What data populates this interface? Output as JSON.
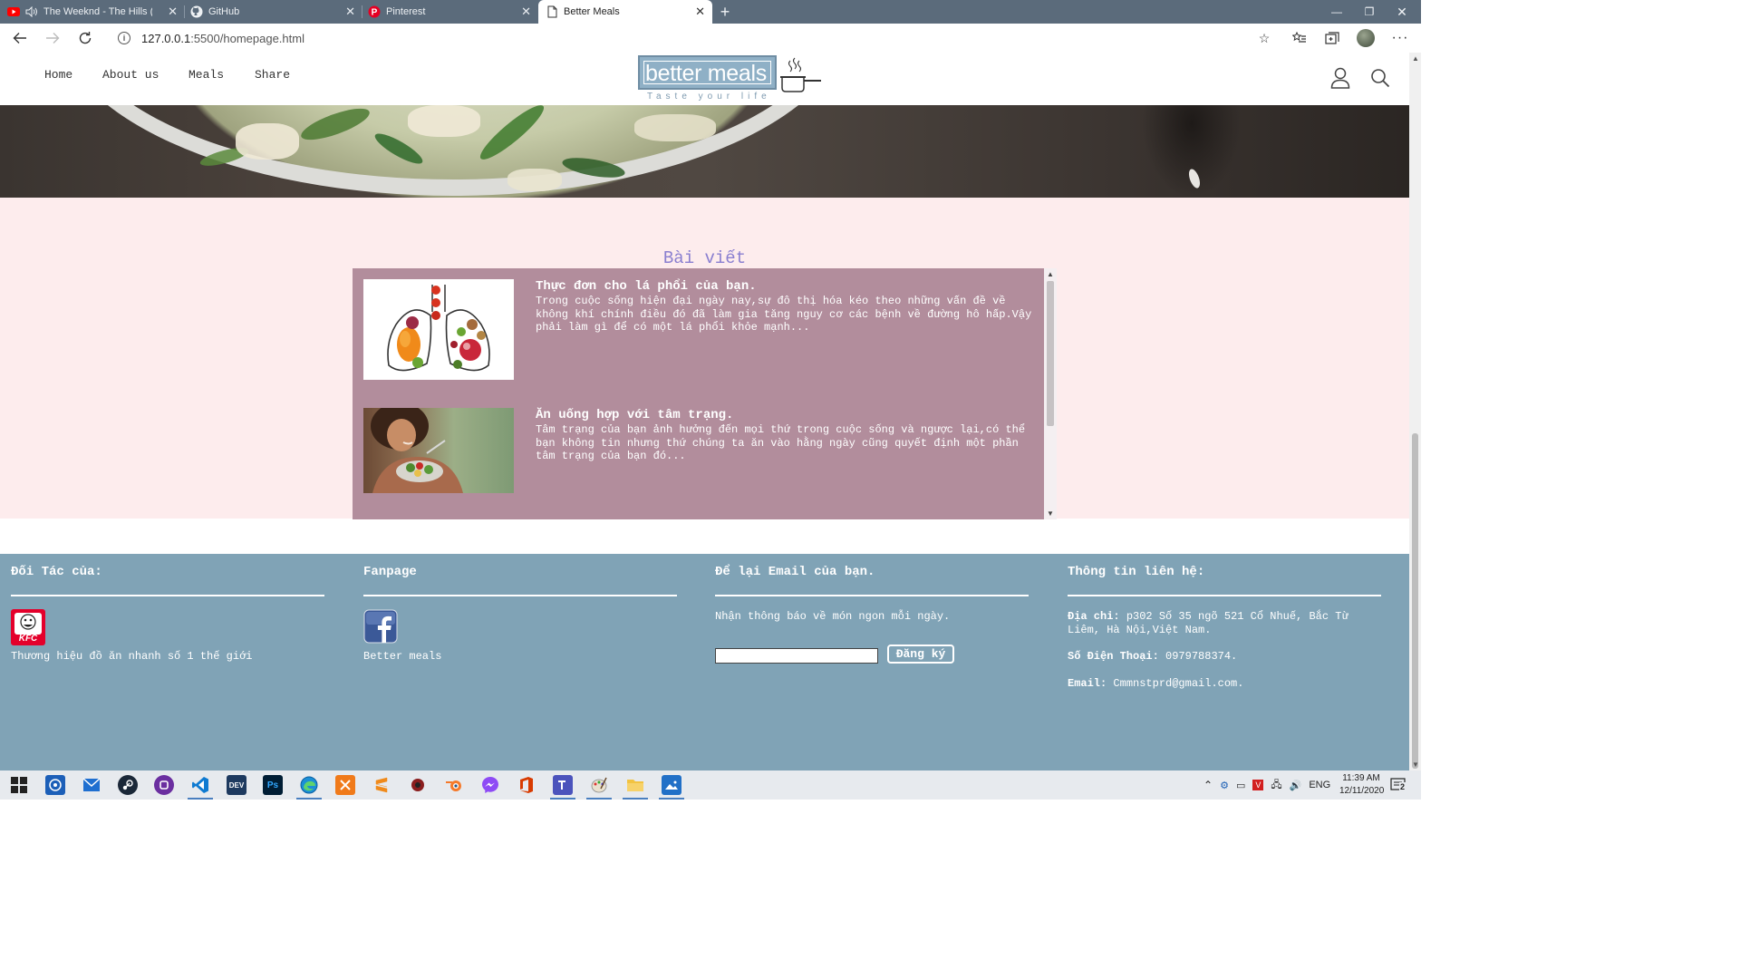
{
  "browser": {
    "tabs": [
      {
        "title": "The Weeknd - The Hills (Am",
        "icon": "youtube-icon"
      },
      {
        "title": "GitHub",
        "icon": "github-icon"
      },
      {
        "title": "Pinterest",
        "icon": "pinterest-icon"
      },
      {
        "title": "Better Meals",
        "icon": "page-icon"
      }
    ],
    "url_host": "127.0.0.1",
    "url_path": ":5500/homepage.html"
  },
  "site": {
    "nav": [
      "Home",
      "About us",
      "Meals",
      "Share"
    ],
    "logo_text": "better meals",
    "logo_tagline": "Taste your life",
    "colors": {
      "posts_bg": "#fdeced",
      "posts_box": "#b28d9c",
      "footer": "#80a3b6",
      "title": "#8a7fd0"
    }
  },
  "posts": {
    "title": "Bài viết",
    "items": [
      {
        "title": "Thực đơn cho lá phổi của bạn.",
        "text": "Trong cuộc sống hiện đại ngày nay,sự đô thị hóa kéo theo những vấn đề về không khí chính điều đó đã làm gia tăng nguy cơ các bệnh về đường hô hấp.Vậy phải làm gì để có một lá phổi khỏe mạnh..."
      },
      {
        "title": "Ăn uống hợp với tâm trạng.",
        "text": "Tâm trạng của bạn ảnh hưởng đến mọi thứ trong cuộc sống và ngược lại,có thể bạn không tin nhưng thứ chúng ta ăn vào hằng ngày cũng quyết định một phần tâm trạng của bạn đó..."
      }
    ]
  },
  "footer": {
    "partners": {
      "heading": "Đối Tác của:",
      "logo_text": "KFC",
      "caption": "Thương hiệu đồ ăn nhanh số 1 thế giới"
    },
    "fanpage": {
      "heading": "Fanpage",
      "caption": "Better meals"
    },
    "email": {
      "heading": "Để lại Email của bạn.",
      "text": "Nhận thông báo về món ngon mỗi ngày.",
      "button": "Đăng ký",
      "value": ""
    },
    "contact": {
      "heading": "Thông tin liên hệ:",
      "address_label": "Địa chỉ:",
      "address": "p302 Số 35 ngõ 521 Cổ Nhuế, Bắc Từ Liêm, Hà Nội,Việt Nam.",
      "phone_label": "Số Điện Thoại:",
      "phone": "0979788374.",
      "email_label": "Email:",
      "email": "Cmmnstprd@gmail.com."
    }
  },
  "taskbar": {
    "lang": "ENG",
    "time": "11:39 AM",
    "date": "12/11/2020",
    "notification_count": "2",
    "dev_label": "DEV",
    "ps_label": "Ps"
  }
}
